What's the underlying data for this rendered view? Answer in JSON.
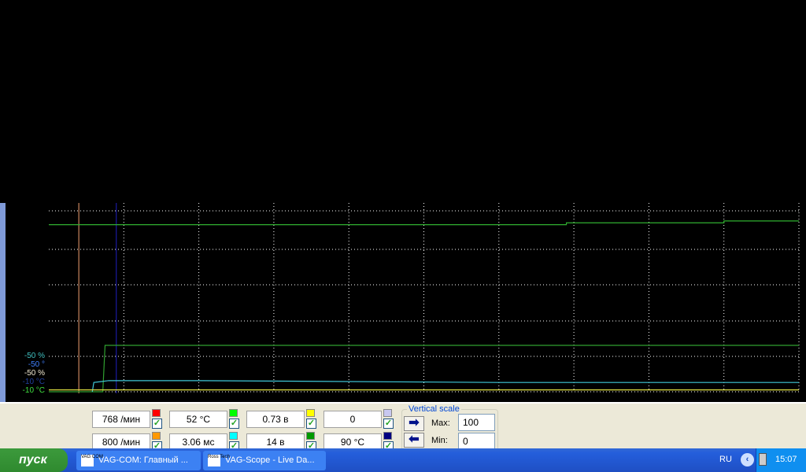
{
  "chart_data": {
    "type": "line",
    "y_labels": [
      {
        "text": "-50 %",
        "color": "#40c0c0"
      },
      {
        "text": "-50 °",
        "color": "#4080ff"
      },
      {
        "text": "-50 %",
        "color": "#f0e8d0"
      },
      {
        "text": "-10 °C",
        "color": "#2040a0"
      },
      {
        "text": "-10 °C",
        "color": "#40e040"
      }
    ],
    "grid": true,
    "series": [
      {
        "name": "green-upper",
        "color": "#30b030",
        "points": [
          [
            0,
            90
          ],
          [
            690,
            90
          ],
          [
            690,
            91
          ],
          [
            900,
            91
          ],
          [
            900,
            92
          ],
          [
            1000,
            92
          ]
        ]
      },
      {
        "name": "green-lower",
        "color": "#30a030",
        "points": [
          [
            0,
            0
          ],
          [
            72,
            0
          ],
          [
            75,
            25
          ],
          [
            1000,
            25
          ]
        ]
      },
      {
        "name": "cyan",
        "color": "#40c8d8",
        "points": [
          [
            58,
            0
          ],
          [
            60,
            5
          ],
          [
            80,
            6
          ],
          [
            200,
            6
          ],
          [
            600,
            5
          ],
          [
            1000,
            5
          ]
        ]
      },
      {
        "name": "yellow",
        "color": "#e0e040",
        "points": [
          [
            0,
            1
          ],
          [
            1000,
            1
          ]
        ]
      }
    ],
    "cursors": [
      {
        "color": "#f0a070",
        "x": 40
      },
      {
        "color": "#2020c0",
        "x": 90
      }
    ]
  },
  "panel": {
    "values": [
      {
        "text": "768 /мин",
        "color": "#ff0000"
      },
      {
        "text": "52 °C",
        "color": "#00ff00"
      },
      {
        "text": "0.73 в",
        "color": "#ffff00"
      },
      {
        "text": "0",
        "color": "#c8c8f0"
      },
      {
        "text": "800 /мин",
        "color": "#ff9900"
      },
      {
        "text": "3.06 мс",
        "color": "#00ffff"
      },
      {
        "text": "14 в",
        "color": "#009900"
      },
      {
        "text": "90 °C",
        "color": "#000080"
      }
    ],
    "vertical_scale": {
      "title": "Vertical scale",
      "max_label": "Max:",
      "max": "100",
      "min_label": "Min:",
      "min": "0"
    }
  },
  "taskbar": {
    "start": "пуск",
    "tasks": [
      {
        "label": "VAG-COM: Главный ...",
        "icon": "VAG COM"
      },
      {
        "label": "VAG-Scope  - Live Da...",
        "icon": "Ross Tech"
      }
    ],
    "lang": "RU",
    "clock": "15:07"
  }
}
